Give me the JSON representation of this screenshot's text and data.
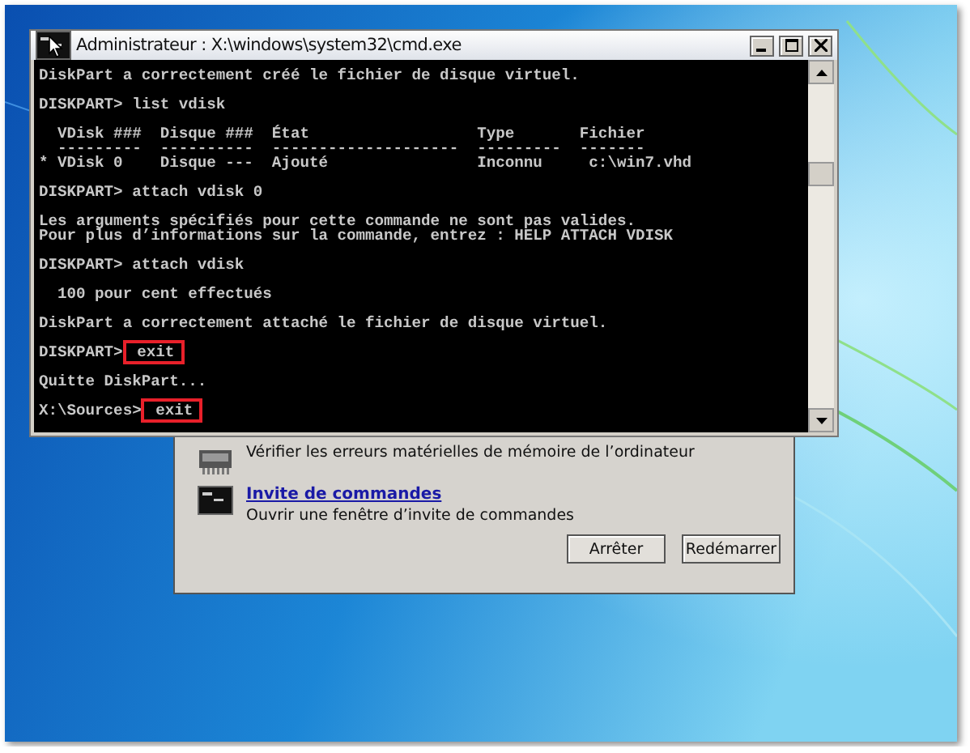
{
  "console_window": {
    "title": "Administrateur : X:\\windows\\system32\\cmd.exe",
    "blocks": [
      {
        "lines": [
          {
            "text": "DiskPart a correctement créé le fichier de disque virtuel."
          }
        ]
      },
      {
        "lines": [
          {
            "prompt": "DISKPART>",
            "command": "list vdisk",
            "highlighted": false
          }
        ]
      },
      {
        "lines": [
          {
            "text": "  VDisk ###  Disque ###  État                  Type       Fichier"
          },
          {
            "text": "  ---------  ----------  --------------------  ---------  -------"
          },
          {
            "text": "* VDisk 0    Disque ---  Ajouté                Inconnu     c:\\win7.vhd"
          }
        ]
      },
      {
        "lines": [
          {
            "prompt": "DISKPART>",
            "command": "attach vdisk 0",
            "highlighted": false
          }
        ]
      },
      {
        "lines": [
          {
            "text": "Les arguments spécifiés pour cette commande ne sont pas valides."
          },
          {
            "text": "Pour plus d’informations sur la commande, entrez : HELP ATTACH VDISK"
          }
        ]
      },
      {
        "lines": [
          {
            "prompt": "DISKPART>",
            "command": "attach vdisk",
            "highlighted": false
          }
        ]
      },
      {
        "lines": [
          {
            "text": "  100 pour cent effectués"
          }
        ]
      },
      {
        "lines": [
          {
            "text": "DiskPart a correctement attaché le fichier de disque virtuel."
          }
        ]
      },
      {
        "lines": [
          {
            "prompt": "DISKPART>",
            "command": "exit",
            "highlighted": true
          }
        ]
      },
      {
        "lines": [
          {
            "text": "Quitte DiskPart..."
          }
        ]
      },
      {
        "lines": [
          {
            "prompt": "X:\\Sources>",
            "command": "exit",
            "highlighted": true
          }
        ]
      }
    ]
  },
  "recovery_dialog": {
    "items": [
      {
        "kind": "memory",
        "description": "Vérifier les erreurs matérielles de mémoire de l’ordinateur"
      },
      {
        "kind": "console",
        "title": "Invite de commandes",
        "description": "Ouvrir une fenêtre d’invite de commandes"
      }
    ],
    "buttons": [
      "Arrêter",
      "Redémarrer"
    ]
  }
}
